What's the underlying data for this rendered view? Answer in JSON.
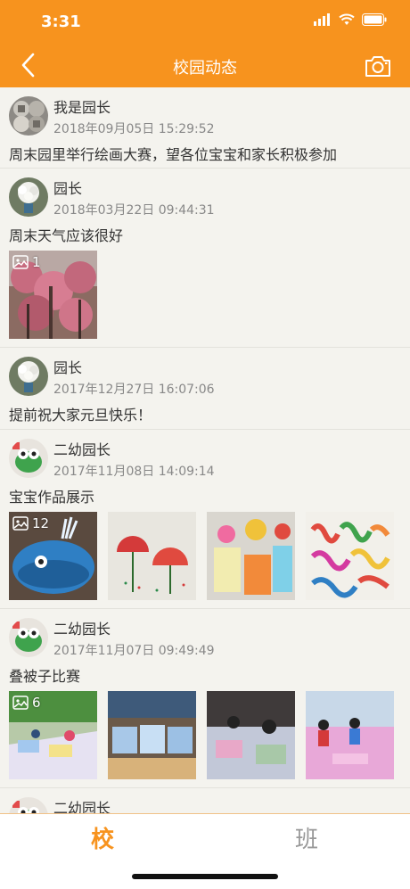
{
  "status_bar": {
    "time": "3:31"
  },
  "nav": {
    "title": "校园动态",
    "back_icon": "chevron-left-icon",
    "camera_icon": "camera-icon"
  },
  "colors": {
    "accent": "#f7931e",
    "background": "#f4f3ee"
  },
  "posts": [
    {
      "author": "我是园长",
      "time": "2018年09月05日 15:29:52",
      "text": "周末园里举行绘画大赛，望各位宝宝和家长积极参加"
    },
    {
      "author": "园长",
      "time": "2018年03月22日 09:44:31",
      "text": "周末天气应该很好",
      "image_count": "1"
    },
    {
      "author": "园长",
      "time": "2017年12月27日 16:07:06",
      "text": "提前祝大家元旦快乐！"
    },
    {
      "author": "二幼园长",
      "time": "2017年11月08日 14:09:14",
      "text": "宝宝作品展示",
      "image_count": "12"
    },
    {
      "author": "二幼园长",
      "time": "2017年11月07日 09:49:49",
      "text": "叠被子比赛",
      "image_count": "6"
    },
    {
      "author": "二幼园长"
    }
  ],
  "tabs": {
    "school": "校",
    "class": "班"
  }
}
